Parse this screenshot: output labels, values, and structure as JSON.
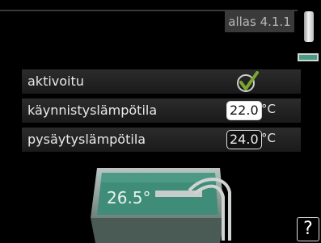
{
  "header": {
    "title": "allas 4.1.1"
  },
  "rows": [
    {
      "label": "aktivoitu",
      "checked": true
    },
    {
      "label": "käynnistyslämpötila",
      "value": "22.0",
      "unit": "°C"
    },
    {
      "label": "pysäytyslämpötila",
      "value": "24.0",
      "unit": "°C"
    }
  ],
  "pool": {
    "temperature": "26.5°"
  },
  "help": {
    "label": "?"
  },
  "colors": {
    "pool_water": "#3f8c79",
    "check": "#7aa631",
    "row": "#2a2a2a"
  }
}
